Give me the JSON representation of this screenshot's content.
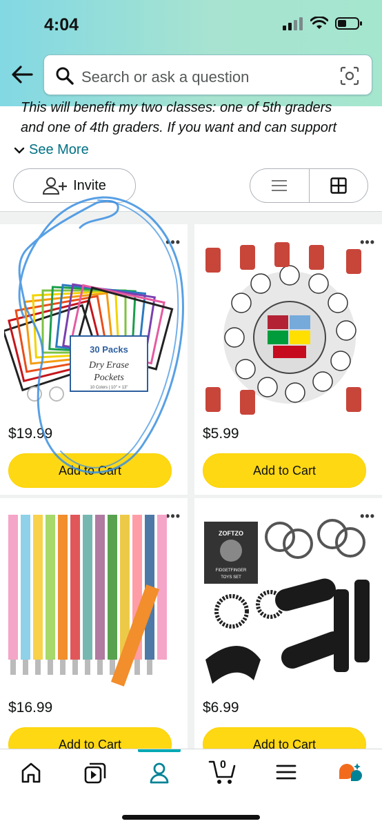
{
  "status_bar": {
    "time": "4:04"
  },
  "search": {
    "placeholder": "Search or ask a question"
  },
  "description": {
    "line1": "This will benefit my two classes: one of 5th graders",
    "line2": "and one of 4th graders. If you want and can support"
  },
  "see_more_label": "See More",
  "invite_label": "Invite",
  "products": [
    {
      "price": "$19.99",
      "cart_label": "Add to Cart",
      "image": "dry-erase-pockets",
      "pack_text": "30 Packs",
      "pack_title1": "Dry Erase",
      "pack_title2": "Pockets",
      "pack_sub": "10 Colors | 10\" × 13\""
    },
    {
      "price": "$5.99",
      "cart_label": "Add to Cart",
      "image": "soccer-stickers"
    },
    {
      "price": "$16.99",
      "cart_label": "Add to Cart",
      "image": "colorful-pens"
    },
    {
      "price": "$6.99",
      "cart_label": "Add to Cart",
      "image": "fidget-toys",
      "box_brand": "ZOFTZO",
      "box_label1": "FIDGETFINGER",
      "box_label2": "TOYS SET"
    }
  ],
  "bottom_nav": [
    "home-icon",
    "video-icon",
    "account-icon",
    "cart-icon",
    "menu-icon",
    "rufus-icon"
  ],
  "cart_count": "0",
  "colors": {
    "accent": "#007185",
    "cart_button": "#ffd814",
    "nav_active": "#00a8b5",
    "scribble": "#3b8fe0"
  }
}
